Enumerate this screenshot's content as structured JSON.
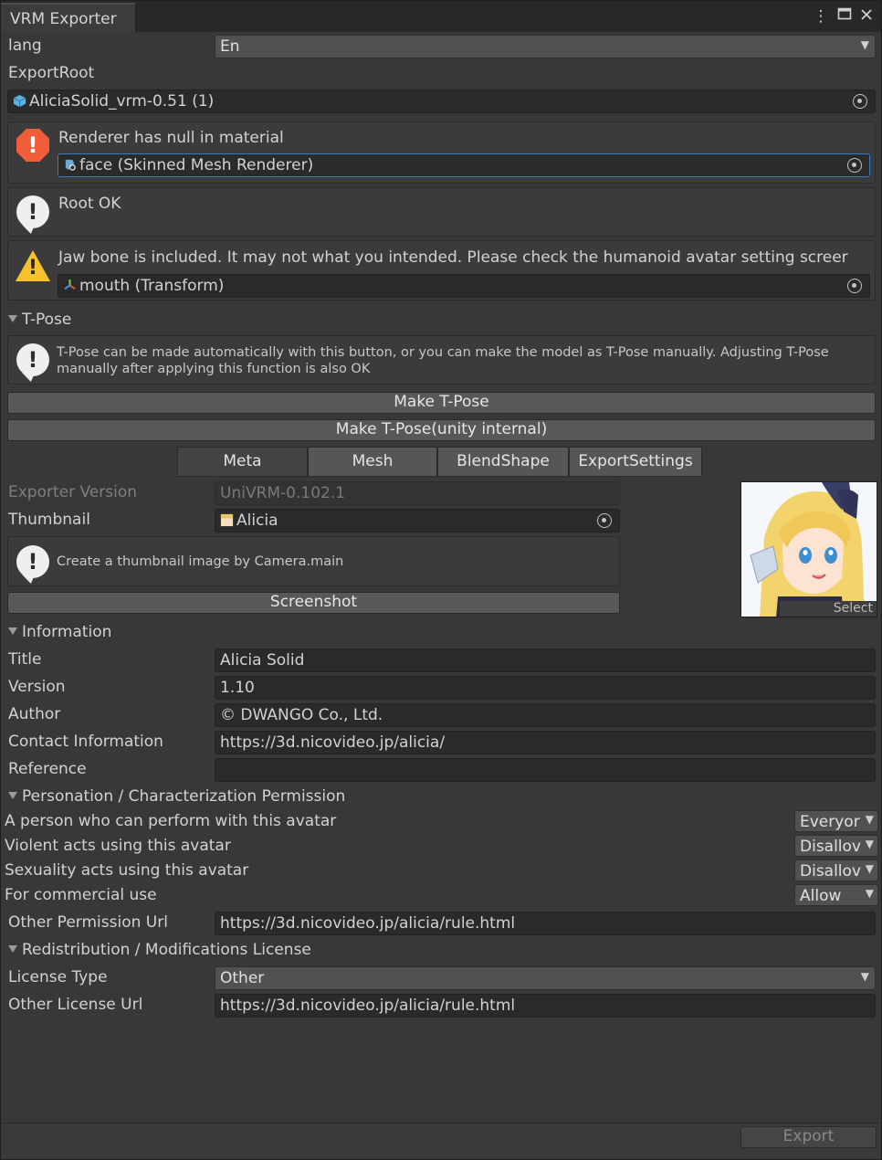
{
  "window": {
    "tab_title": "VRM Exporter"
  },
  "lang": {
    "label": "lang",
    "value": "En"
  },
  "export_root": {
    "label": "ExportRoot",
    "value": "AliciaSolid_vrm-0.51 (1)"
  },
  "validation": [
    {
      "level": "error",
      "message": "Renderer has null in material",
      "object": "face (Skinned Mesh Renderer)"
    },
    {
      "level": "info",
      "message": "Root OK"
    },
    {
      "level": "warning",
      "message": "Jaw bone is included. It may not what you intended. Please check the humanoid avatar setting screer",
      "object": "mouth (Transform)"
    }
  ],
  "tpose": {
    "header": "T-Pose",
    "info": "T-Pose can be made automatically with this button, or you can make the model as T-Pose manually. Adjusting T-Pose manually after applying this function is also OK",
    "make_button": "Make T-Pose",
    "make_internal_button": "Make T-Pose(unity internal)"
  },
  "tabs": [
    "Meta",
    "Mesh",
    "BlendShape",
    "ExportSettings"
  ],
  "meta": {
    "exporter_version_label": "Exporter Version",
    "exporter_version": "UniVRM-0.102.1",
    "thumbnail_label": "Thumbnail",
    "thumbnail_value": "Alicia",
    "thumbnail_info": "Create a thumbnail image by Camera.main",
    "screenshot_button": "Screenshot",
    "thumbnail_select": "Select"
  },
  "information": {
    "header": "Information",
    "title_label": "Title",
    "title": "Alicia Solid",
    "version_label": "Version",
    "version": "1.10",
    "author_label": "Author",
    "author": "© DWANGO Co., Ltd.",
    "contact_label": "Contact Information",
    "contact": "https://3d.nicovideo.jp/alicia/",
    "reference_label": "Reference",
    "reference": ""
  },
  "permission": {
    "header": "Personation / Characterization Permission",
    "who_label": "A person who can perform with this avatar",
    "who": "Everyor",
    "violent_label": "Violent acts using this avatar",
    "violent": "Disallov",
    "sexual_label": "Sexuality acts using this avatar",
    "sexual": "Disallov",
    "commercial_label": "For commercial use",
    "commercial": "Allow",
    "other_url_label": "Other Permission Url",
    "other_url": "https://3d.nicovideo.jp/alicia/rule.html"
  },
  "license": {
    "header": "Redistribution / Modifications License",
    "type_label": "License Type",
    "type": "Other",
    "other_url_label": "Other License Url",
    "other_url": "https://3d.nicovideo.jp/alicia/rule.html"
  },
  "footer": {
    "export_button": "Export"
  },
  "colors": {
    "error": "#f05d38",
    "warning": "#f7c22e",
    "focus": "#3a79bb"
  }
}
